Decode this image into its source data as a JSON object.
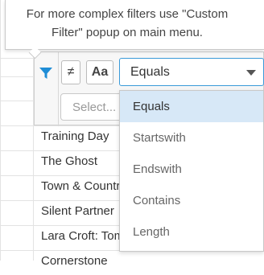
{
  "tooltip": {
    "line1": "For more complex filters use \"Custom",
    "line2": "Filter\" popup on main menu."
  },
  "filter_panel": {
    "icon": "filter-icon",
    "not_equal_label": "≠",
    "match_case_label": "Aa",
    "operator_value": "Equals",
    "search_placeholder": "Select...",
    "accent_color": "#1f8dd6"
  },
  "dropdown": {
    "options": [
      "Equals",
      "Startswith",
      "Endswith",
      "Contains",
      "Length"
    ],
    "selected": "Equals"
  },
  "grid_rows": [
    "Training Day",
    "The Ghost",
    "Town & Country",
    "Silent Partner",
    "Lara Croft: Tomb Raider",
    "Cornerstone"
  ]
}
